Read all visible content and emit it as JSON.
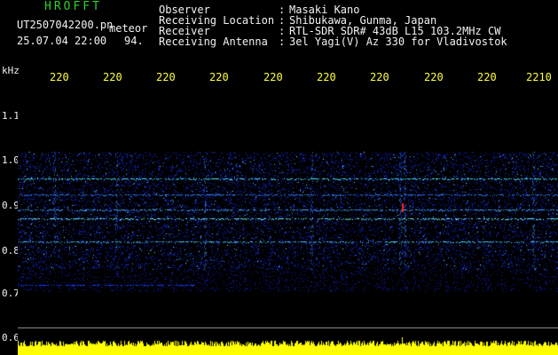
{
  "header": {
    "logo": "HROFFT",
    "file_name": "UT2507042200.pn",
    "meteor_label": "meteor",
    "datetime": "25.07.04 22:00",
    "count": "94.",
    "rows": [
      {
        "label": "Observer",
        "value": "Masaki Kano"
      },
      {
        "label": "Receiving Location",
        "value": "Shibukawa, Gunma, Japan"
      },
      {
        "label": "Receiver",
        "value": "RTL-SDR SDR# 43dB L15 103.2MHz CW"
      },
      {
        "label": "Receiving Antenna",
        "value": "3el Yagi(V) Az 330 for Vladivostok"
      }
    ]
  },
  "axis": {
    "y_unit": "kHz",
    "y_labels": [
      "1.1",
      "1.0",
      "0.9",
      "0.8",
      "0.7",
      "0.6"
    ],
    "x_labels": [
      "220",
      "220",
      "220",
      "220",
      "220",
      "220",
      "220",
      "220",
      "220",
      "2210"
    ]
  },
  "colors": {
    "background": "#000000",
    "title_green": "#3cd23c",
    "tick_yellow": "#ffff3a",
    "meter_yellow": "#ffff00",
    "signal_blue": "#1f3dff",
    "signal_cyan": "#44e8ff",
    "meteor_red": "#ff2020"
  }
}
